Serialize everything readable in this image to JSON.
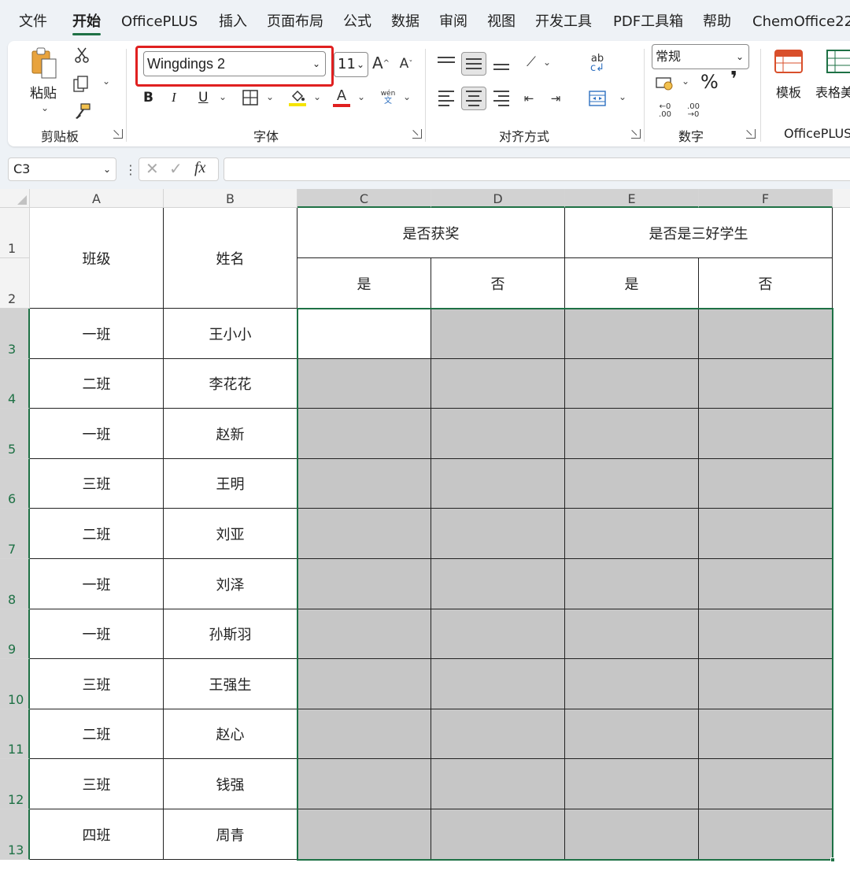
{
  "menu": {
    "tabs": [
      "文件",
      "开始",
      "OfficePLUS",
      "插入",
      "页面布局",
      "公式",
      "数据",
      "审阅",
      "视图",
      "开发工具",
      "PDF工具箱",
      "帮助",
      "ChemOffice22"
    ],
    "active": "开始"
  },
  "ribbon": {
    "clipboard": {
      "paste_label": "粘贴",
      "group_label": "剪贴板"
    },
    "font": {
      "font_name": "Wingdings 2",
      "font_size": "11",
      "group_label": "字体",
      "bold": "B",
      "italic": "I",
      "underline": "U",
      "phonetic_top": "wén",
      "phonetic_bottom": "文"
    },
    "alignment": {
      "group_label": "对齐方式"
    },
    "number": {
      "format": "常规",
      "percent": "%",
      "comma": "❜",
      "group_label": "数字"
    },
    "officeplus": {
      "template_label": "模板",
      "table_label": "表格美",
      "group_label": "OfficePLUS"
    }
  },
  "formula_bar": {
    "name_box": "C3",
    "fx": "fx",
    "formula": ""
  },
  "sheet": {
    "columns": [
      "A",
      "B",
      "C",
      "D",
      "E",
      "F"
    ],
    "row_numbers": [
      "1",
      "2",
      "3",
      "4",
      "5",
      "6",
      "7",
      "8",
      "9",
      "10",
      "11",
      "12",
      "13"
    ],
    "header": {
      "class": "班级",
      "name": "姓名",
      "award": "是否获奖",
      "merit": "是否是三好学生",
      "yes": "是",
      "no": "否"
    },
    "rows": [
      {
        "class": "一班",
        "name": "王小小"
      },
      {
        "class": "二班",
        "name": "李花花"
      },
      {
        "class": "一班",
        "name": "赵新"
      },
      {
        "class": "三班",
        "name": "王明"
      },
      {
        "class": "二班",
        "name": "刘亚"
      },
      {
        "class": "一班",
        "name": "刘泽"
      },
      {
        "class": "一班",
        "name": "孙斯羽"
      },
      {
        "class": "三班",
        "name": "王强生"
      },
      {
        "class": "二班",
        "name": "赵心"
      },
      {
        "class": "三班",
        "name": "钱强"
      },
      {
        "class": "四班",
        "name": "周青"
      }
    ],
    "selection": "C3:F13"
  },
  "colors": {
    "accent": "#1e7145",
    "highlight_box": "#e02020",
    "selection_fill": "#c6c6c6",
    "underline_bar": "#e02020",
    "fill_bar": "#f5e400"
  }
}
